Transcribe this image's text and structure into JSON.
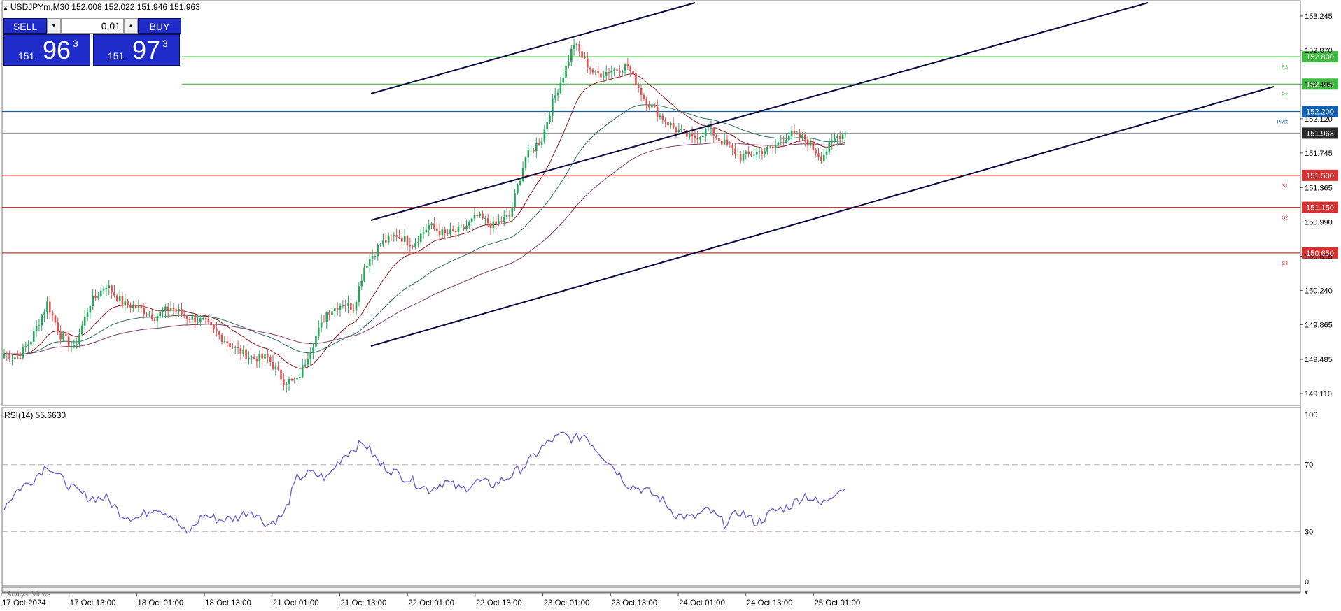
{
  "window": {
    "symbol_title": "USDJPYm,M30  152.008 152.022 151.946 151.963",
    "rsi_title": "RSI(14) 55.6630"
  },
  "trade_panel": {
    "sell_label": "SELL",
    "buy_label": "BUY",
    "lot_value": "0.01",
    "sell_price": {
      "small": "151",
      "big": "96",
      "sup": "3"
    },
    "buy_price": {
      "small": "151",
      "big": "97",
      "sup": "3"
    }
  },
  "price_axis": {
    "ticks": [
      "153.245",
      "152.870",
      "152.495",
      "152.120",
      "151.745",
      "151.365",
      "150.990",
      "150.615",
      "150.240",
      "149.865",
      "149.485",
      "149.110"
    ],
    "tick_values": [
      153.245,
      152.87,
      152.495,
      152.12,
      151.745,
      151.365,
      150.99,
      150.615,
      150.24,
      149.865,
      149.485,
      149.11
    ]
  },
  "levels": [
    {
      "label": "152.800",
      "value": 152.8,
      "color": "#3dbb3d",
      "tag": "R3"
    },
    {
      "label": "152.500",
      "value": 152.5,
      "color": "#3dbb3d",
      "tag": "R2"
    },
    {
      "label": "152.200",
      "value": 152.2,
      "color": "#1060b0",
      "tag": "Pivot"
    },
    {
      "label": "151.963",
      "value": 151.963,
      "color": "#2a2a2a",
      "tag": ""
    },
    {
      "label": "151.500",
      "value": 151.5,
      "color": "#d63030",
      "tag": "S1"
    },
    {
      "label": "151.150",
      "value": 151.15,
      "color": "#d63030",
      "tag": "S2"
    },
    {
      "label": "150.650",
      "value": 150.65,
      "color": "#d63030",
      "tag": "S3"
    }
  ],
  "rsi_axis": {
    "ticks": [
      "100",
      "70",
      "30",
      "0"
    ],
    "tick_values": [
      100,
      70,
      30,
      0
    ]
  },
  "time_axis": {
    "labels": [
      "17 Oct 2024",
      "17 Oct 13:00",
      "18 Oct 01:00",
      "18 Oct 13:00",
      "21 Oct 01:00",
      "21 Oct 13:00",
      "22 Oct 01:00",
      "22 Oct 13:00",
      "23 Oct 01:00",
      "23 Oct 13:00",
      "24 Oct 01:00",
      "24 Oct 13:00",
      "25 Oct 01:00"
    ]
  },
  "bottom_panel_label": "Analyst Views",
  "colors": {
    "bull": "#26a65b",
    "bear": "#e05050",
    "ma_fast": "#8b1a1a",
    "ma_mid": "#2f6b5f",
    "ma_slow": "#7a3a6a",
    "rsi": "#6a5acd",
    "channel": "#0a0a40"
  },
  "chart_data": {
    "type": "candlestick",
    "symbol": "USDJPYm",
    "timeframe": "M30",
    "ohlc_last": {
      "open": 152.008,
      "high": 152.022,
      "low": 151.946,
      "close": 151.963
    },
    "close_path": [
      [
        0,
        149.55
      ],
      [
        5,
        149.5
      ],
      [
        10,
        149.7
      ],
      [
        16,
        150.1
      ],
      [
        21,
        149.75
      ],
      [
        26,
        149.6
      ],
      [
        32,
        150.1
      ],
      [
        38,
        150.3
      ],
      [
        44,
        150.1
      ],
      [
        50,
        150.05
      ],
      [
        56,
        149.95
      ],
      [
        62,
        150.05
      ],
      [
        68,
        149.95
      ],
      [
        74,
        149.9
      ],
      [
        80,
        149.75
      ],
      [
        86,
        149.6
      ],
      [
        92,
        149.5
      ],
      [
        98,
        149.5
      ],
      [
        104,
        149.25
      ],
      [
        109,
        149.25
      ],
      [
        114,
        149.6
      ],
      [
        120,
        150.0
      ],
      [
        126,
        150.1
      ],
      [
        130,
        150.05
      ],
      [
        134,
        150.5
      ],
      [
        140,
        150.75
      ],
      [
        146,
        150.85
      ],
      [
        152,
        150.75
      ],
      [
        158,
        150.95
      ],
      [
        164,
        150.85
      ],
      [
        170,
        150.9
      ],
      [
        176,
        151.05
      ],
      [
        182,
        150.95
      ],
      [
        188,
        151.05
      ],
      [
        194,
        151.7
      ],
      [
        200,
        151.9
      ],
      [
        204,
        152.3
      ],
      [
        208,
        152.6
      ],
      [
        212,
        152.95
      ],
      [
        216,
        152.75
      ],
      [
        220,
        152.6
      ],
      [
        226,
        152.65
      ],
      [
        232,
        152.7
      ],
      [
        238,
        152.35
      ],
      [
        244,
        152.15
      ],
      [
        250,
        152.0
      ],
      [
        256,
        151.9
      ],
      [
        262,
        152.0
      ],
      [
        268,
        151.85
      ],
      [
        274,
        151.7
      ],
      [
        280,
        151.75
      ],
      [
        286,
        151.8
      ],
      [
        292,
        151.95
      ],
      [
        298,
        151.9
      ],
      [
        304,
        151.7
      ],
      [
        310,
        151.93
      ],
      [
        313,
        151.963
      ]
    ],
    "rsi_path": [
      [
        0,
        45
      ],
      [
        5,
        55
      ],
      [
        10,
        60
      ],
      [
        16,
        70
      ],
      [
        21,
        62
      ],
      [
        26,
        55
      ],
      [
        32,
        50
      ],
      [
        38,
        50
      ],
      [
        44,
        40
      ],
      [
        50,
        38
      ],
      [
        56,
        45
      ],
      [
        62,
        40
      ],
      [
        68,
        28
      ],
      [
        74,
        40
      ],
      [
        80,
        37
      ],
      [
        86,
        38
      ],
      [
        92,
        43
      ],
      [
        98,
        34
      ],
      [
        104,
        40
      ],
      [
        109,
        62
      ],
      [
        114,
        65
      ],
      [
        120,
        62
      ],
      [
        126,
        75
      ],
      [
        130,
        80
      ],
      [
        134,
        83
      ],
      [
        140,
        70
      ],
      [
        146,
        65
      ],
      [
        152,
        60
      ],
      [
        158,
        55
      ],
      [
        164,
        60
      ],
      [
        170,
        55
      ],
      [
        176,
        60
      ],
      [
        182,
        58
      ],
      [
        188,
        63
      ],
      [
        194,
        70
      ],
      [
        200,
        80
      ],
      [
        204,
        85
      ],
      [
        208,
        88
      ],
      [
        212,
        85
      ],
      [
        216,
        88
      ],
      [
        220,
        80
      ],
      [
        226,
        70
      ],
      [
        232,
        58
      ],
      [
        238,
        55
      ],
      [
        244,
        50
      ],
      [
        250,
        40
      ],
      [
        256,
        38
      ],
      [
        262,
        43
      ],
      [
        268,
        35
      ],
      [
        274,
        42
      ],
      [
        280,
        35
      ],
      [
        286,
        42
      ],
      [
        292,
        45
      ],
      [
        298,
        52
      ],
      [
        304,
        46
      ],
      [
        310,
        55
      ],
      [
        313,
        55.663
      ]
    ],
    "rsi_period": 14,
    "rsi_value": 55.663,
    "ylim": [
      149.0,
      153.35
    ],
    "rsi_ylim": [
      0,
      100
    ]
  }
}
